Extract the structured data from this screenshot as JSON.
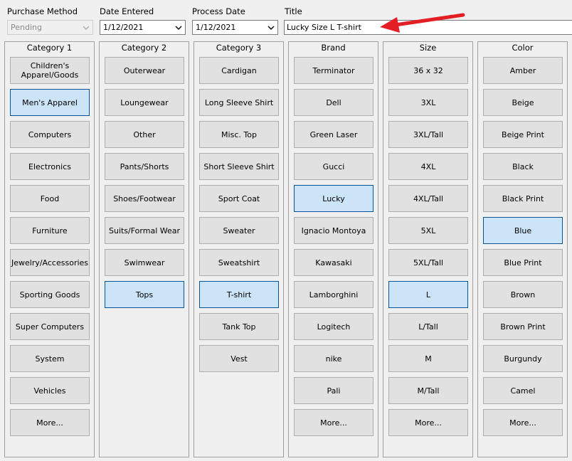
{
  "fields": {
    "purchase_method": {
      "label": "Purchase Method",
      "value": "Pending"
    },
    "date_entered": {
      "label": "Date Entered",
      "value": "1/12/2021"
    },
    "process_date": {
      "label": "Process Date",
      "value": "1/12/2021"
    },
    "title": {
      "label": "Title",
      "value": "Lucky Size L T-shirt"
    }
  },
  "columns": [
    {
      "header": "Category 1",
      "items": [
        {
          "label": "Children's\nApparel/Goods",
          "selected": false
        },
        {
          "label": "Men's Apparel",
          "selected": true
        },
        {
          "label": "Computers",
          "selected": false
        },
        {
          "label": "Electronics",
          "selected": false
        },
        {
          "label": "Food",
          "selected": false
        },
        {
          "label": "Furniture",
          "selected": false
        },
        {
          "label": "Jewelry/Accessories",
          "selected": false
        },
        {
          "label": "Sporting Goods",
          "selected": false
        },
        {
          "label": "Super Computers",
          "selected": false
        },
        {
          "label": "System",
          "selected": false
        },
        {
          "label": "Vehicles",
          "selected": false
        },
        {
          "label": "More...",
          "selected": false
        }
      ]
    },
    {
      "header": "Category 2",
      "items": [
        {
          "label": "Outerwear",
          "selected": false
        },
        {
          "label": "Loungewear",
          "selected": false
        },
        {
          "label": "Other",
          "selected": false
        },
        {
          "label": "Pants/Shorts",
          "selected": false
        },
        {
          "label": "Shoes/Footwear",
          "selected": false
        },
        {
          "label": "Suits/Formal Wear",
          "selected": false
        },
        {
          "label": "Swimwear",
          "selected": false
        },
        {
          "label": "Tops",
          "selected": true
        }
      ]
    },
    {
      "header": "Category 3",
      "items": [
        {
          "label": "Cardigan",
          "selected": false
        },
        {
          "label": "Long Sleeve Shirt",
          "selected": false
        },
        {
          "label": "Misc. Top",
          "selected": false
        },
        {
          "label": "Short Sleeve Shirt",
          "selected": false
        },
        {
          "label": "Sport Coat",
          "selected": false
        },
        {
          "label": "Sweater",
          "selected": false
        },
        {
          "label": "Sweatshirt",
          "selected": false
        },
        {
          "label": "T-shirt",
          "selected": true
        },
        {
          "label": "Tank Top",
          "selected": false
        },
        {
          "label": "Vest",
          "selected": false
        }
      ]
    },
    {
      "header": "Brand",
      "items": [
        {
          "label": "Terminator",
          "selected": false
        },
        {
          "label": "Dell",
          "selected": false
        },
        {
          "label": "Green Laser",
          "selected": false
        },
        {
          "label": "Gucci",
          "selected": false
        },
        {
          "label": "Lucky",
          "selected": true
        },
        {
          "label": "Ignacio Montoya",
          "selected": false
        },
        {
          "label": "Kawasaki",
          "selected": false
        },
        {
          "label": "Lamborghini",
          "selected": false
        },
        {
          "label": "Logitech",
          "selected": false
        },
        {
          "label": "nike",
          "selected": false
        },
        {
          "label": "Pali",
          "selected": false
        },
        {
          "label": "More...",
          "selected": false
        }
      ]
    },
    {
      "header": "Size",
      "items": [
        {
          "label": "36 x 32",
          "selected": false
        },
        {
          "label": "3XL",
          "selected": false
        },
        {
          "label": "3XL/Tall",
          "selected": false
        },
        {
          "label": "4XL",
          "selected": false
        },
        {
          "label": "4XL/Tall",
          "selected": false
        },
        {
          "label": "5XL",
          "selected": false
        },
        {
          "label": "5XL/Tall",
          "selected": false
        },
        {
          "label": "L",
          "selected": true
        },
        {
          "label": "L/Tall",
          "selected": false
        },
        {
          "label": "M",
          "selected": false
        },
        {
          "label": "M/Tall",
          "selected": false
        },
        {
          "label": "More...",
          "selected": false
        }
      ]
    },
    {
      "header": "Color",
      "items": [
        {
          "label": "Amber",
          "selected": false
        },
        {
          "label": "Beige",
          "selected": false
        },
        {
          "label": "Beige Print",
          "selected": false
        },
        {
          "label": "Black",
          "selected": false
        },
        {
          "label": "Black Print",
          "selected": false
        },
        {
          "label": "Blue",
          "selected": true
        },
        {
          "label": "Blue Print",
          "selected": false
        },
        {
          "label": "Brown",
          "selected": false
        },
        {
          "label": "Brown Print",
          "selected": false
        },
        {
          "label": "Burgundy",
          "selected": false
        },
        {
          "label": "Camel",
          "selected": false
        },
        {
          "label": "More...",
          "selected": false
        }
      ]
    }
  ],
  "colors": {
    "selected_bg": "#cce4f7",
    "selected_border": "#005499",
    "button_bg": "#e1e1e1",
    "arrow": "#e31e24"
  },
  "icons": {
    "dropdown": "chevron-down-icon",
    "annotation": "red-arrow-icon"
  }
}
